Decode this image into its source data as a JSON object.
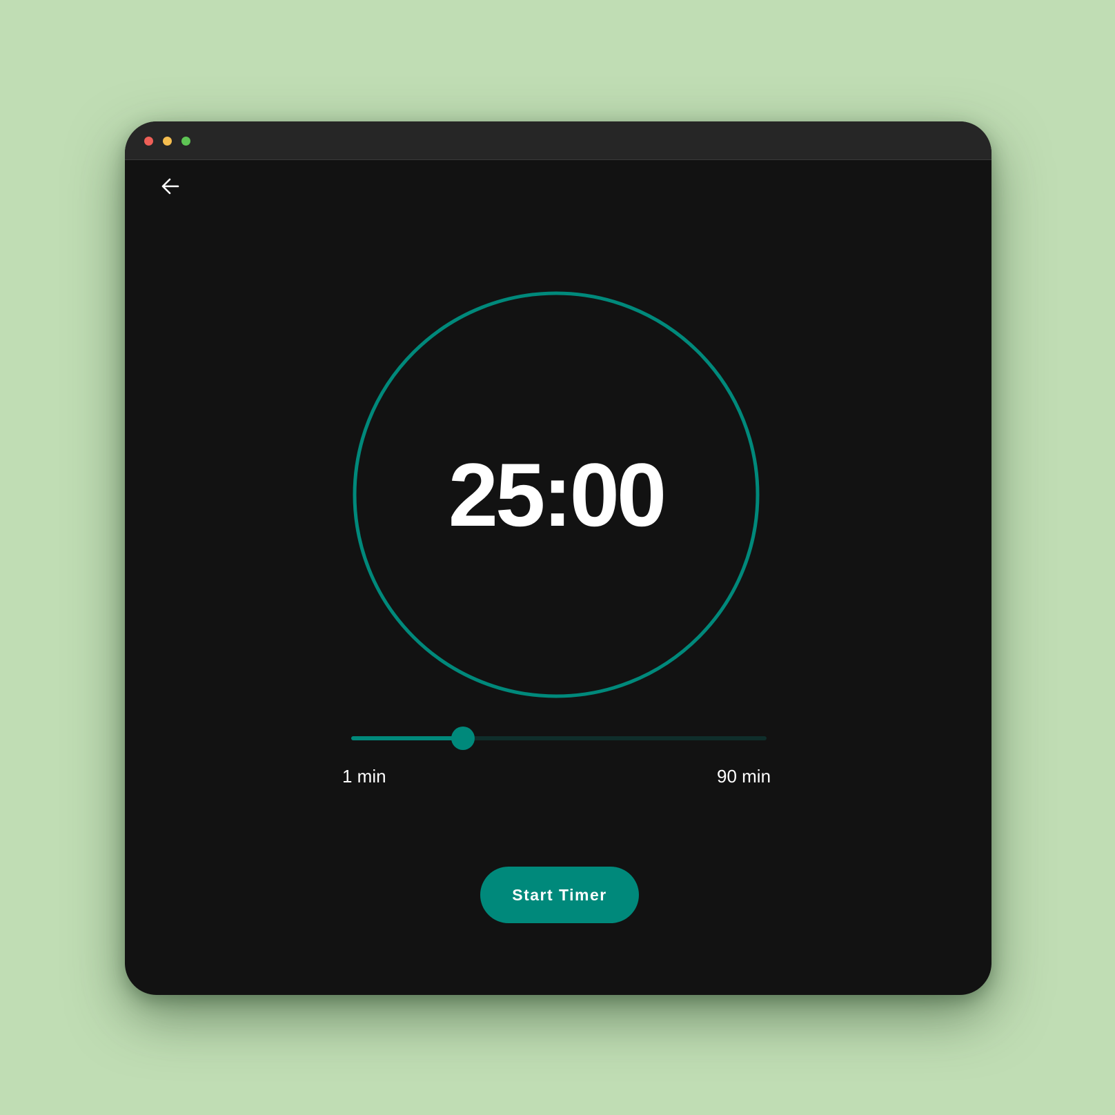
{
  "window": {
    "controls": [
      {
        "name": "close",
        "color": "#ee5f57"
      },
      {
        "name": "minimize",
        "color": "#f5bd4f"
      },
      {
        "name": "maximize",
        "color": "#5ec454"
      }
    ]
  },
  "nav": {
    "back_icon": "arrow-left-icon"
  },
  "timer": {
    "display": "25:00",
    "ring_color": "#00897b"
  },
  "duration_slider": {
    "min_label": "1 min",
    "max_label": "90 min",
    "min": 1,
    "max": 90,
    "value": 25,
    "accent": "#00897b",
    "track_color": "#0f2e2b"
  },
  "actions": {
    "start_label": "Start Timer"
  }
}
